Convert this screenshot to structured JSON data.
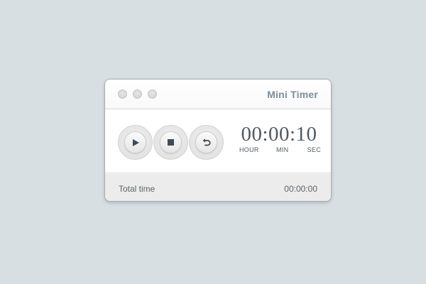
{
  "window": {
    "title": "Mini Timer"
  },
  "controls": {
    "play_icon": "play-icon",
    "stop_icon": "stop-icon",
    "reset_icon": "reset-icon"
  },
  "clock": {
    "display": "00:00:10",
    "units": {
      "hour": "HOUR",
      "min": "MIN",
      "sec": "SEC"
    }
  },
  "footer": {
    "label": "Total time",
    "value": "00:00:00"
  },
  "colors": {
    "background": "#d7dfe2",
    "title": "#7d8d99",
    "digits": "#505a62",
    "icon": "#3f4a55"
  }
}
